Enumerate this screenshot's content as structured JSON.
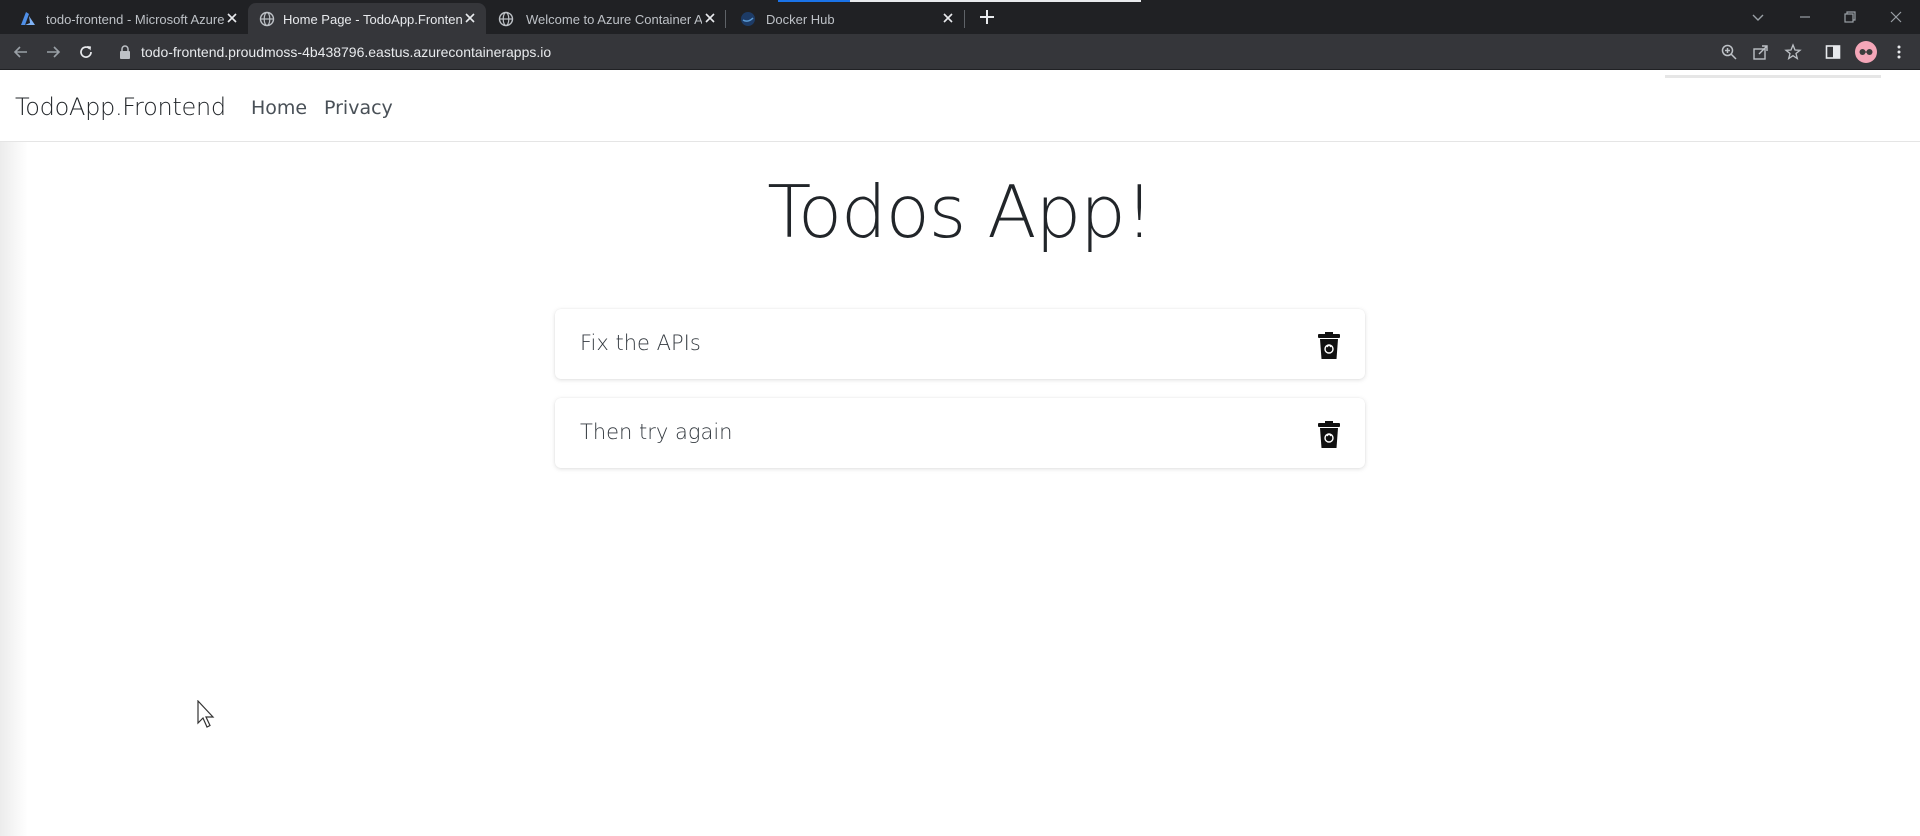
{
  "browser": {
    "tabs": [
      {
        "title": "todo-frontend - Microsoft Azure",
        "favicon": "azure-icon",
        "active": false
      },
      {
        "title": "Home Page - TodoApp.Frontend",
        "favicon": "globe-icon",
        "active": true
      },
      {
        "title": "Welcome to Azure Container Apps",
        "favicon": "globe-icon",
        "active": false
      },
      {
        "title": "Docker Hub",
        "favicon": "docker-icon",
        "active": false
      }
    ],
    "url": "todo-frontend.proudmoss-4b438796.eastus.azurecontainerapps.io",
    "colors": {
      "tabstrip": "#202124",
      "toolbar": "#35363a",
      "accent": "#1a73e8"
    }
  },
  "app": {
    "brand": "TodoApp.Frontend",
    "nav": [
      {
        "label": "Home"
      },
      {
        "label": "Privacy"
      }
    ],
    "heading": "Todos App!",
    "todos": [
      {
        "text": "Fix the APIs",
        "action_icon": "trash-icon"
      },
      {
        "text": "Then try again",
        "action_icon": "trash-icon"
      }
    ]
  }
}
